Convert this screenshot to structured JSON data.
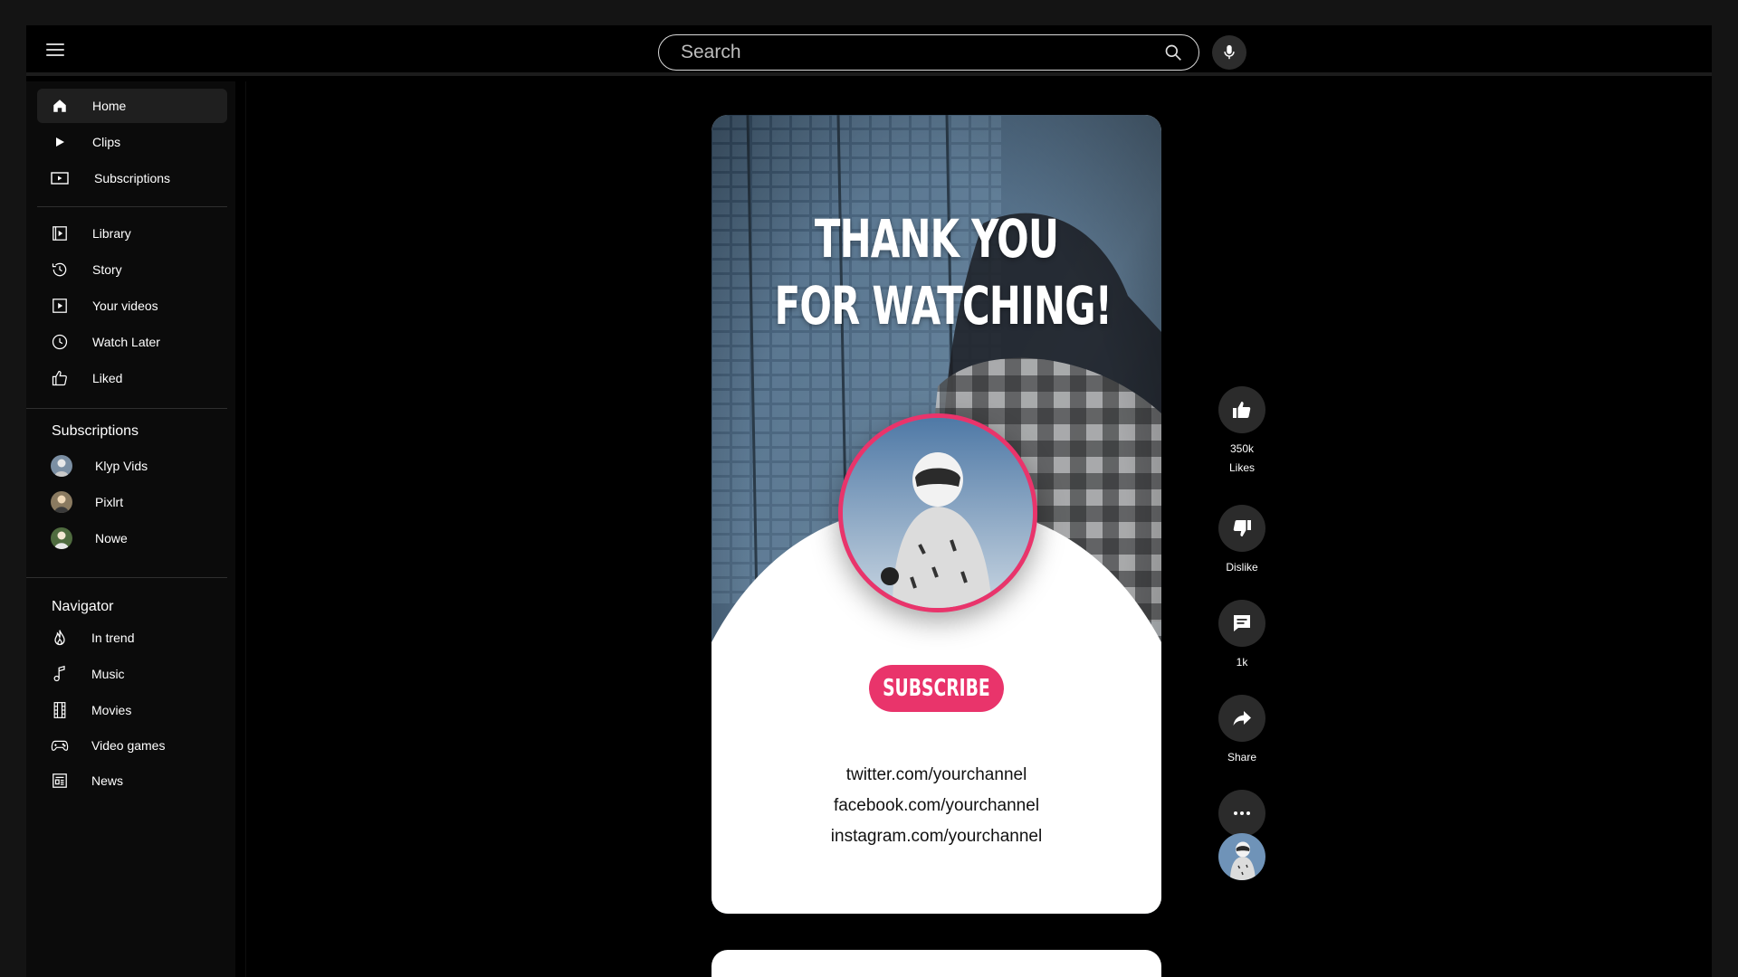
{
  "topbar": {
    "search_placeholder": "Search"
  },
  "sidebar": {
    "main_items": [
      {
        "label": "Home",
        "icon": "home-icon"
      },
      {
        "label": "Clips",
        "icon": "play-icon"
      },
      {
        "label": "Subscriptions",
        "icon": "subscriptions-icon"
      }
    ],
    "library_items": [
      {
        "label": "Library",
        "icon": "library-icon"
      },
      {
        "label": "Story",
        "icon": "history-icon"
      },
      {
        "label": "Your videos",
        "icon": "your-videos-icon"
      },
      {
        "label": "Watch Later",
        "icon": "clock-icon"
      },
      {
        "label": "Liked",
        "icon": "thumbs-up-icon"
      }
    ],
    "subscriptions_title": "Subscriptions",
    "subscriptions": [
      {
        "label": "Klyp Vids"
      },
      {
        "label": "Pixlrt"
      },
      {
        "label": "Nowe"
      }
    ],
    "navigator_title": "Navigator",
    "navigator_items": [
      {
        "label": "In trend",
        "icon": "flame-icon"
      },
      {
        "label": "Music",
        "icon": "music-note-icon"
      },
      {
        "label": "Movies",
        "icon": "film-icon"
      },
      {
        "label": "Video games",
        "icon": "gamepad-icon"
      },
      {
        "label": "News",
        "icon": "newspaper-icon"
      }
    ]
  },
  "video": {
    "title_line1": "THANK YOU",
    "title_line2": "FOR WATCHING!",
    "subscribe_label": "SUBSCRIBE",
    "links": [
      "twitter.com/yourchannel",
      "facebook.com/yourchannel",
      "instagram.com/yourchannel"
    ],
    "accent_color": "#e9346b"
  },
  "actions": {
    "likes_count": "350k",
    "likes_label": "Likes",
    "dislike_label": "Dislike",
    "comments_count": "1k",
    "share_label": "Share"
  }
}
